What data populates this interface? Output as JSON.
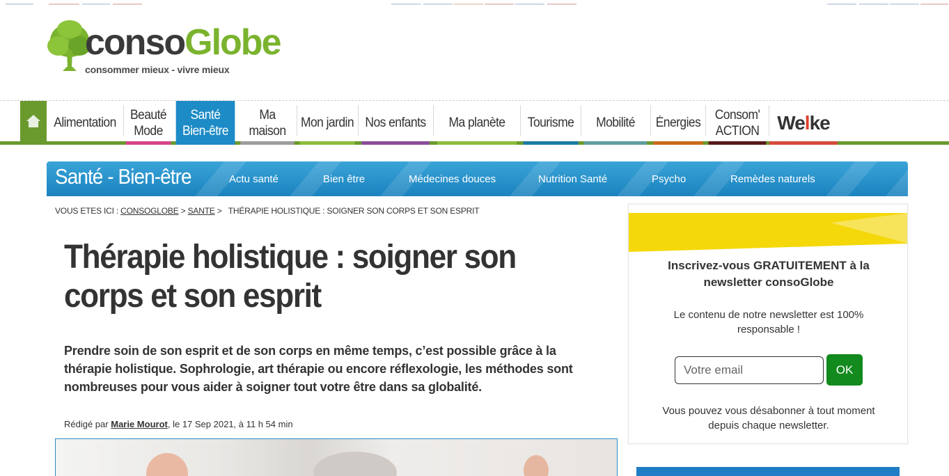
{
  "logo": {
    "name_part1": "conso",
    "name_part2": "Globe",
    "tagline": "consommer mieux - vivre mieux"
  },
  "colors": {
    "brand_green": "#6a9a2e",
    "brand_blue": "#1d8bc6",
    "ok_button": "#128a1d",
    "sidebar_yellow": "#f5d80a"
  },
  "nav": {
    "home_icon": "house-icon",
    "items": [
      {
        "label": "Alimentation",
        "line2": "",
        "color": "#6a9a2e"
      },
      {
        "label": "Beauté",
        "line2": "Mode",
        "color": "#d8428a"
      },
      {
        "label": "Santé",
        "line2": "Bien-être",
        "color": "#1d8bc6"
      },
      {
        "label": "Ma",
        "line2": "maison",
        "color": "#9d9d9d"
      },
      {
        "label": "Mon jardin",
        "line2": "",
        "color": "#8cbd3a"
      },
      {
        "label": "Nos enfants",
        "line2": "",
        "color": "#8a4d9c"
      },
      {
        "label": "Ma planète",
        "line2": "",
        "color": "#8cbd3a"
      },
      {
        "label": "Tourisme",
        "line2": "",
        "color": "#1b7ba3"
      },
      {
        "label": "Mobilité",
        "line2": "",
        "color": "#5f9ea0"
      },
      {
        "label": "Énergies",
        "line2": "",
        "color": "#c96b1a"
      },
      {
        "label": "Consom'",
        "line2": "ACTION",
        "color": "#5a1a1a"
      },
      {
        "label": "We",
        "line2": "",
        "color": "#d44a3a"
      }
    ],
    "welike_part1": "We",
    "welike_part2": "l",
    "welike_part3": "ke"
  },
  "section": {
    "title": "Santé - Bien-être",
    "links": [
      "Actu santé",
      "Bien être",
      "Médecines douces",
      "Nutrition Santé",
      "Psycho",
      "Remèdes naturels"
    ]
  },
  "breadcrumb": {
    "prefix": "VOUS ETES ICI :",
    "crumb1": "CONSOGLOBE",
    "sep": ">",
    "crumb2": "SANTE",
    "current": "THÉRAPIE HOLISTIQUE : SOIGNER SON CORPS ET SON ESPRIT"
  },
  "article": {
    "title": "Thérapie holistique : soigner son corps et son esprit",
    "lead": "Prendre soin de son esprit et de son corps en même temps, c’est possible grâce à la thérapie holistique. Sophrologie, art thérapie ou encore réflexologie, les méthodes sont nombreuses pour vous aider à soigner tout votre être dans sa globalité.",
    "byline_prefix": "Rédigé par",
    "author": "Marie Mourot",
    "byline_date": ", le 17 Sep 2021, à 11 h 54 min"
  },
  "newsletter": {
    "title": "Inscrivez-vous GRATUITEMENT à la newsletter consoGlobe",
    "text": "Le contenu de notre newsletter est 100% responsable !",
    "email_placeholder": "Votre email",
    "ok_label": "OK",
    "footer": "Vous pouvez vous désabonner à tout moment depuis chaque newsletter."
  }
}
